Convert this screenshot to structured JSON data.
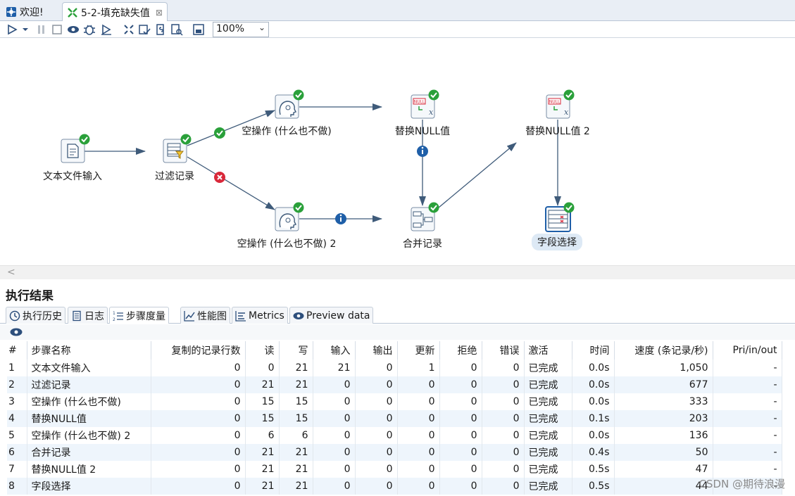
{
  "tabs": [
    {
      "label": "欢迎!",
      "icon": "welcome-icon"
    },
    {
      "label": "5-2-填充缺失值",
      "icon": "transformation-icon",
      "close": "⊠"
    }
  ],
  "toolbar": {
    "zoom": "100%",
    "buttons": [
      "run-icon",
      "run-dropdown-icon",
      "pause-icon",
      "stop-icon",
      "preview-icon",
      "debug-icon",
      "replay-icon",
      "verify-icon",
      "impact-icon",
      "sql-icon",
      "explore-db-icon",
      "show-results-icon"
    ]
  },
  "canvas": {
    "nodes": [
      {
        "id": "text-input",
        "label": "文本文件输入",
        "icon": "text-file-input-icon"
      },
      {
        "id": "filter",
        "label": "过滤记录",
        "icon": "filter-rows-icon"
      },
      {
        "id": "dummy1",
        "label": "空操作 (什么也不做)",
        "icon": "dummy-icon"
      },
      {
        "id": "dummy2",
        "label": "空操作 (什么也不做) 2",
        "icon": "dummy-icon"
      },
      {
        "id": "ifnull1",
        "label": "替换NULL值",
        "icon": "if-null-icon"
      },
      {
        "id": "merge",
        "label": "合并记录",
        "icon": "merge-rows-icon"
      },
      {
        "id": "ifnull2",
        "label": "替换NULL值 2",
        "icon": "if-null-icon"
      },
      {
        "id": "select",
        "label": "字段选择",
        "icon": "select-values-icon"
      }
    ],
    "null_badge": "NULL"
  },
  "results": {
    "title": "执行结果",
    "tabs": [
      {
        "label": "执行历史",
        "icon": "history-icon"
      },
      {
        "label": "日志",
        "icon": "log-icon"
      },
      {
        "label": "步骤度量",
        "icon": "step-metrics-icon"
      },
      {
        "label": "性能图",
        "icon": "performance-graph-icon"
      },
      {
        "label": "Metrics",
        "icon": "metrics-icon"
      },
      {
        "label": "Preview data",
        "icon": "preview-eye-icon"
      }
    ],
    "columns": [
      "#",
      "步骤名称",
      "复制的记录行数",
      "读",
      "写",
      "输入",
      "输出",
      "更新",
      "拒绝",
      "错误",
      "激活",
      "时间",
      "速度 (条记录/秒)",
      "Pri/in/out"
    ],
    "rows": [
      [
        "1",
        "文本文件输入",
        "0",
        "0",
        "21",
        "21",
        "0",
        "1",
        "0",
        "0",
        "已完成",
        "0.0s",
        "1,050",
        "-"
      ],
      [
        "2",
        "过滤记录",
        "0",
        "21",
        "21",
        "0",
        "0",
        "0",
        "0",
        "0",
        "已完成",
        "0.0s",
        "677",
        "-"
      ],
      [
        "3",
        "空操作 (什么也不做)",
        "0",
        "15",
        "15",
        "0",
        "0",
        "0",
        "0",
        "0",
        "已完成",
        "0.0s",
        "333",
        "-"
      ],
      [
        "4",
        "替换NULL值",
        "0",
        "15",
        "15",
        "0",
        "0",
        "0",
        "0",
        "0",
        "已完成",
        "0.1s",
        "203",
        "-"
      ],
      [
        "5",
        "空操作 (什么也不做) 2",
        "0",
        "6",
        "6",
        "0",
        "0",
        "0",
        "0",
        "0",
        "已完成",
        "0.0s",
        "136",
        "-"
      ],
      [
        "6",
        "合并记录",
        "0",
        "21",
        "21",
        "0",
        "0",
        "0",
        "0",
        "0",
        "已完成",
        "0.4s",
        "50",
        "-"
      ],
      [
        "7",
        "替换NULL值 2",
        "0",
        "21",
        "21",
        "0",
        "0",
        "0",
        "0",
        "0",
        "已完成",
        "0.5s",
        "47",
        "-"
      ],
      [
        "8",
        "字段选择",
        "0",
        "21",
        "21",
        "0",
        "0",
        "0",
        "0",
        "0",
        "已完成",
        "0.5s",
        "44",
        "-"
      ]
    ]
  },
  "watermark": "CSDN @期待浪漫"
}
